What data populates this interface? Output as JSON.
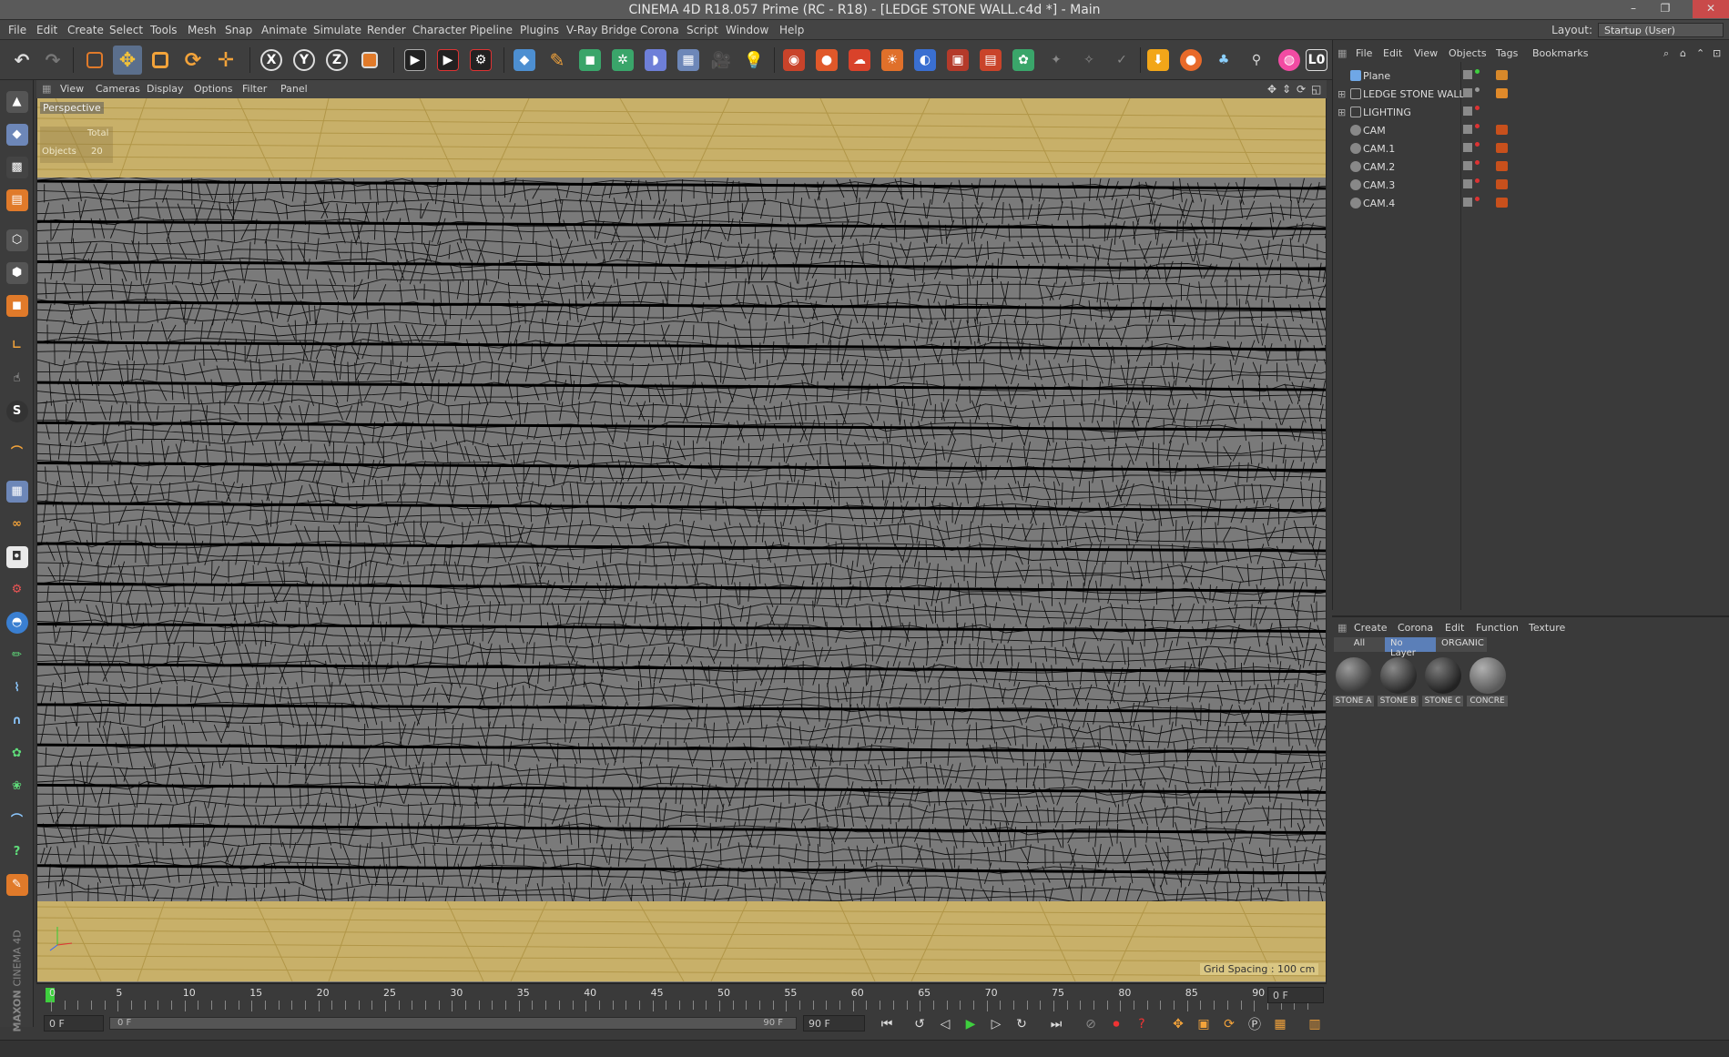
{
  "window": {
    "title": "CINEMA 4D R18.057 Prime (RC - R18) - [LEDGE STONE WALL.c4d *] - Main"
  },
  "menubar": {
    "items": [
      "File",
      "Edit",
      "Create",
      "Select",
      "Tools",
      "Mesh",
      "Snap",
      "Animate",
      "Simulate",
      "Render",
      "Character",
      "Pipeline",
      "Plugins",
      "V-Ray Bridge",
      "Corona",
      "Script",
      "Window",
      "Help"
    ],
    "layout_label": "Layout:",
    "layout_value": "Startup (User)"
  },
  "toolbar": {
    "axis_x": "X",
    "axis_y": "Y",
    "axis_z": "Z"
  },
  "viewport": {
    "menu": [
      "View",
      "Cameras",
      "Display",
      "Options",
      "Filter",
      "Panel"
    ],
    "camera_label": "Perspective",
    "stats": {
      "header": "Total",
      "objects_label": "Objects",
      "objects_value": "20"
    },
    "grid_spacing": "Grid Spacing : 100 cm",
    "wire_color": "#111111",
    "surface_color": "#7a7a7a",
    "floor_color": "#c8b069"
  },
  "timeline": {
    "ticks": [
      "0",
      "5",
      "10",
      "15",
      "20",
      "25",
      "30",
      "35",
      "40",
      "45",
      "50",
      "55",
      "60",
      "65",
      "70",
      "75",
      "80",
      "85",
      "90"
    ],
    "current_frame": "0 F"
  },
  "transport": {
    "start_field": "0 F",
    "scrub_left": "0 F",
    "scrub_right": "90 F",
    "end_field": "90 F"
  },
  "object_manager": {
    "menu": [
      "File",
      "Edit",
      "View",
      "Objects",
      "Tags",
      "Bookmarks"
    ],
    "objects": [
      {
        "name": "Plane"
      },
      {
        "name": "LEDGE STONE WALL"
      },
      {
        "name": "LIGHTING"
      },
      {
        "name": "CAM"
      },
      {
        "name": "CAM.1"
      },
      {
        "name": "CAM.2"
      },
      {
        "name": "CAM.3"
      },
      {
        "name": "CAM.4"
      }
    ]
  },
  "material_manager": {
    "menu": [
      "Create",
      "Corona",
      "Edit",
      "Function",
      "Texture"
    ],
    "tabs": [
      "All",
      "No Layer",
      "ORGANIC"
    ],
    "materials": [
      "STONE A",
      "STONE B",
      "STONE C",
      "CONCRE"
    ]
  },
  "branding": {
    "maxon": "MAXON",
    "c4d": "CINEMA 4D"
  }
}
